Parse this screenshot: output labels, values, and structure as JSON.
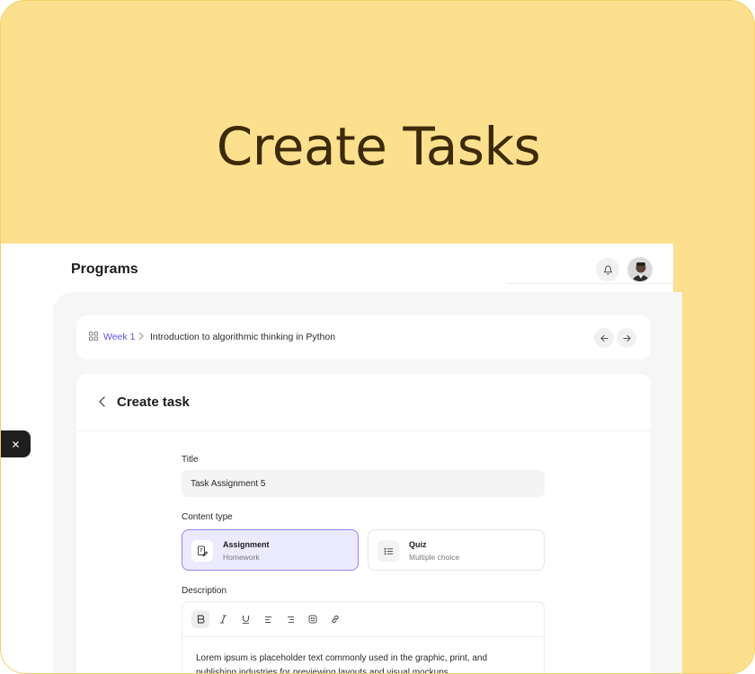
{
  "hero": {
    "title": "Create Tasks"
  },
  "header": {
    "title": "Programs"
  },
  "breadcrumb": {
    "week": "Week 1",
    "page": "Introduction to algorithmic thinking in Python"
  },
  "form": {
    "heading": "Create task",
    "title_label": "Title",
    "title_value": "Task Assignment 5",
    "content_type_label": "Content type",
    "options": [
      {
        "name": "Assignment",
        "sub": "Homework",
        "selected": true
      },
      {
        "name": "Quiz",
        "sub": "Multiple choice",
        "selected": false
      }
    ],
    "description_label": "Description",
    "description_text": "Lorem ipsum is placeholder text commonly used in the graphic, print, and publishing industries for previewing layouts and visual mockups."
  },
  "colors": {
    "hero_bg": "#fde08e",
    "accent": "#5b54e6",
    "selected_bg": "#eceaff"
  }
}
